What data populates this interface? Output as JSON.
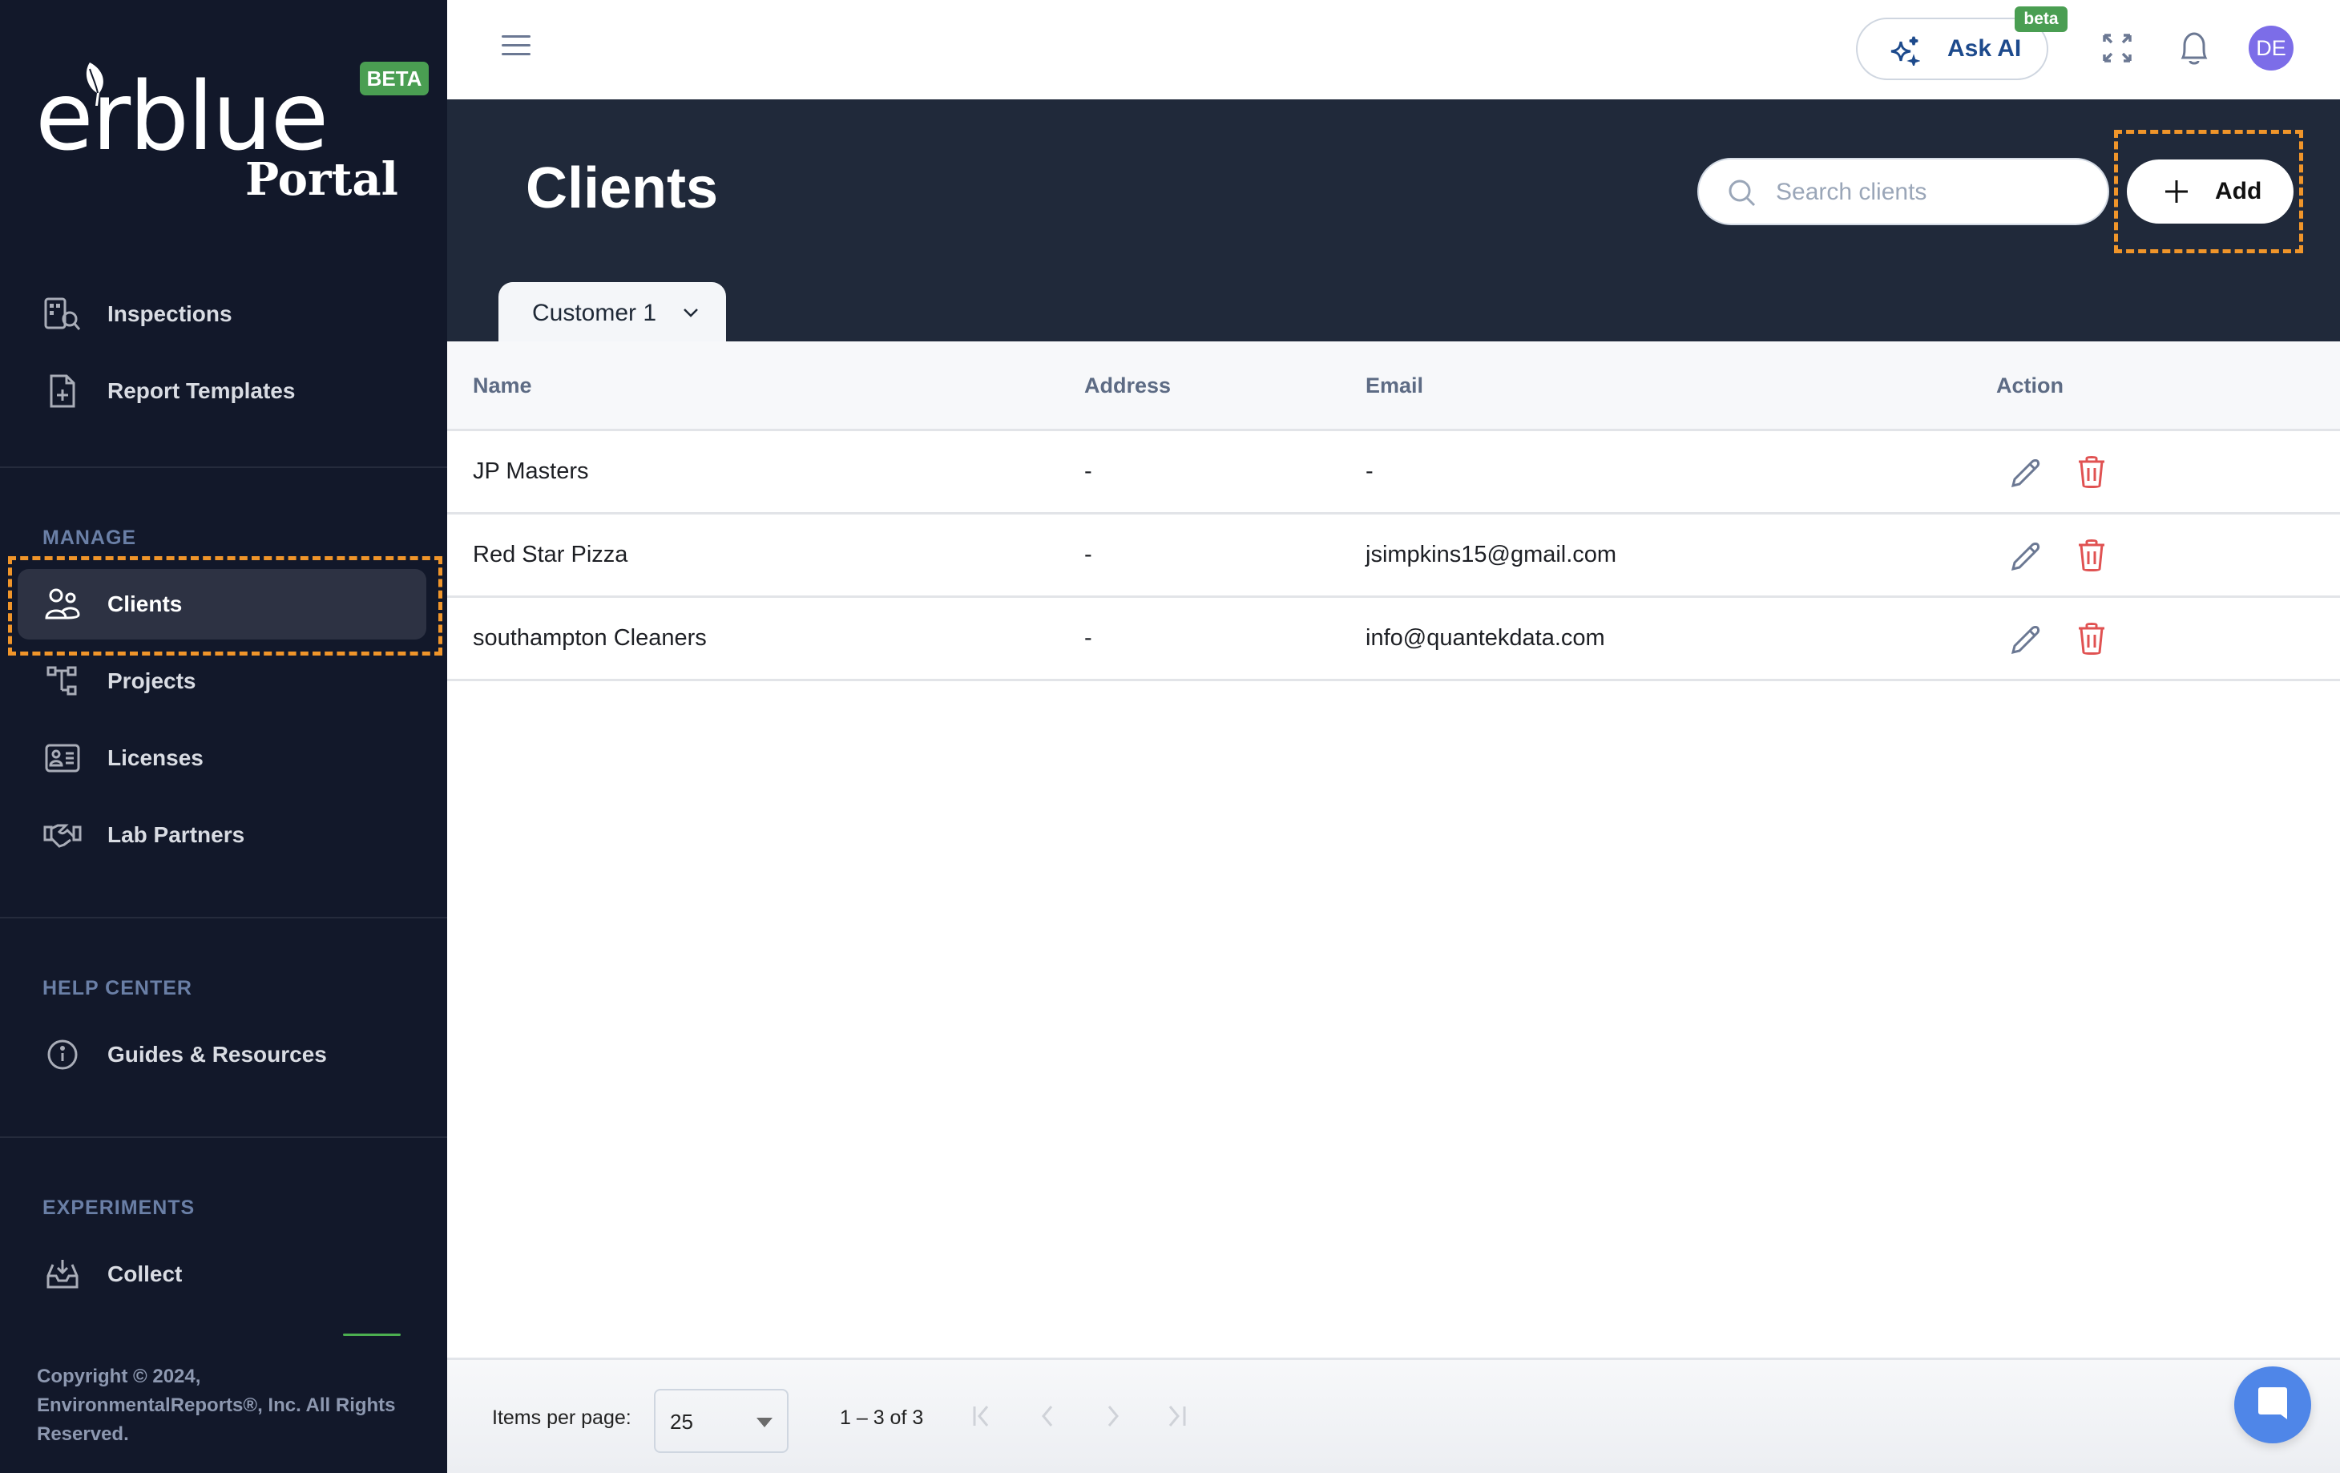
{
  "app": {
    "logo_word": "erblue",
    "logo_sub": "Portal",
    "logo_badge": "BETA"
  },
  "sidebar": {
    "top_items": [
      {
        "label": "Inspections",
        "icon": "building-search-icon"
      },
      {
        "label": "Report Templates",
        "icon": "file-plus-icon"
      }
    ],
    "sections": [
      {
        "title": "MANAGE",
        "items": [
          {
            "label": "Clients",
            "icon": "users-icon",
            "active": true
          },
          {
            "label": "Projects",
            "icon": "hierarchy-icon"
          },
          {
            "label": "Licenses",
            "icon": "id-card-icon"
          },
          {
            "label": "Lab Partners",
            "icon": "handshake-icon"
          }
        ]
      },
      {
        "title": "HELP CENTER",
        "items": [
          {
            "label": "Guides & Resources",
            "icon": "info-icon"
          }
        ]
      },
      {
        "title": "EXPERIMENTS",
        "items": [
          {
            "label": "Collect",
            "icon": "inbox-download-icon"
          }
        ]
      }
    ],
    "copyright": "Copyright © 2024, EnvironmentalReports®, Inc. All Rights Reserved."
  },
  "topbar": {
    "ask_ai_label": "Ask AI",
    "ask_ai_badge": "beta",
    "avatar_initials": "DE"
  },
  "header": {
    "title": "Clients",
    "search_placeholder": "Search clients",
    "search_value": "",
    "add_label": "Add",
    "tab_label": "Customer 1"
  },
  "table": {
    "columns": [
      "Name",
      "Address",
      "Email",
      "Action"
    ],
    "rows": [
      {
        "name": "JP Masters",
        "address": "-",
        "email": "-"
      },
      {
        "name": "Red Star Pizza",
        "address": "-",
        "email": "jsimpkins15@gmail.com"
      },
      {
        "name": "southampton Cleaners",
        "address": "-",
        "email": "info@quantekdata.com"
      }
    ]
  },
  "pagination": {
    "items_per_page_label": "Items per page:",
    "items_per_page": "25",
    "range": "1 – 3 of 3"
  },
  "colors": {
    "sidebar_bg": "#12182a",
    "header_bg": "#20293a",
    "accent_green": "#4a9e52",
    "highlight": "#f0952a",
    "avatar": "#7c6de8",
    "delete": "#e05252",
    "chat_fab": "#4f86e8"
  }
}
